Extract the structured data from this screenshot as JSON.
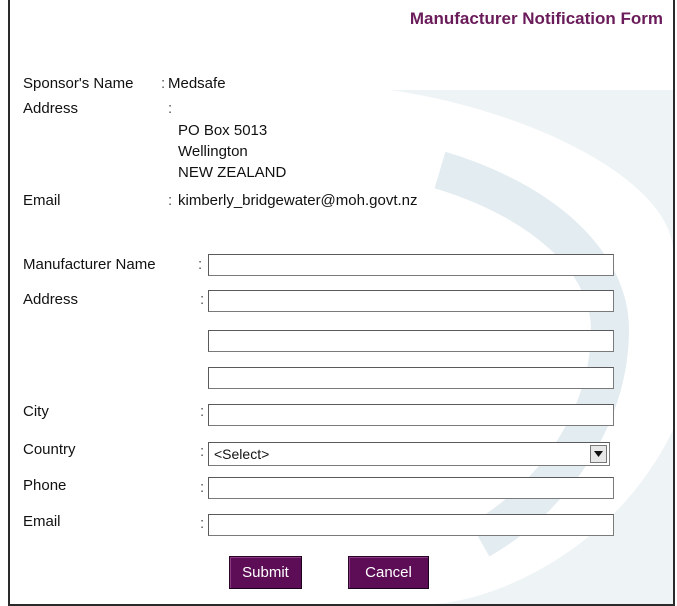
{
  "form": {
    "title": "Manufacturer Notification Form"
  },
  "sponsor": {
    "name_label": "Sponsor's Name",
    "name_value": "Medsafe",
    "address_label": "Address",
    "address_lines": [
      "PO Box 5013",
      "Wellington",
      "NEW ZEALAND"
    ],
    "email_label": "Email",
    "email_value": "kimberly_bridgewater@moh.govt.nz"
  },
  "manufacturer": {
    "name_label": "Manufacturer Name",
    "address_label": "Address",
    "city_label": "City",
    "country_label": "Country",
    "country_selected": "<Select>",
    "phone_label": "Phone",
    "email_label": "Email"
  },
  "separator": ":",
  "buttons": {
    "submit": "Submit",
    "cancel": "Cancel"
  },
  "colors": {
    "title": "#6a1b5a",
    "button": "#5c0d55",
    "watermark": "#eef3f6"
  }
}
